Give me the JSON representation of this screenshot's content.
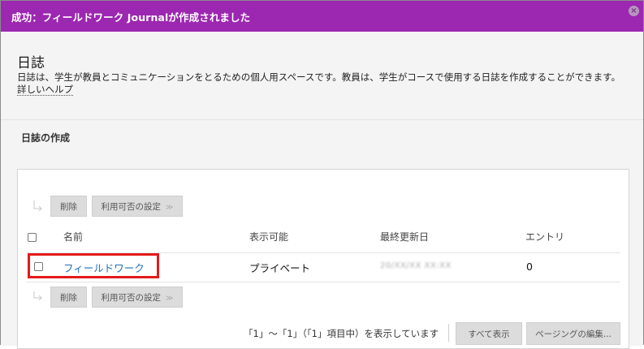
{
  "success": {
    "message": "成功：フィールドワーク Journalが作成されました",
    "close_icon": "close-icon"
  },
  "intro": {
    "title": "日誌",
    "description": "日誌は、学生が教員とコミュニケーションをとるための個人用スペースです。教員は、学生がコースで使用する日誌を作成することができます。",
    "help_link": "詳しいヘルプ"
  },
  "section": {
    "label": "日誌の作成"
  },
  "actions": {
    "delete_label": "削除",
    "availability_label": "利用可否の設定"
  },
  "table": {
    "headers": {
      "name": "名前",
      "visibility": "表示可能",
      "last_updated": "最終更新日",
      "entries": "エントリ"
    },
    "rows": [
      {
        "name": "フィールドワーク",
        "visibility": "プライベート",
        "last_updated": "20/XX/XX XX:XX",
        "entries": "0"
      }
    ]
  },
  "pager": {
    "summary": "「1」～「1」（「1」項目中）を表示しています",
    "show_all_label": "すべて表示",
    "edit_paging_label": "ページングの編集..."
  },
  "colors": {
    "success_bar": "#9c27b0",
    "link": "#1e6fb7",
    "highlight": "#e41a1a"
  }
}
